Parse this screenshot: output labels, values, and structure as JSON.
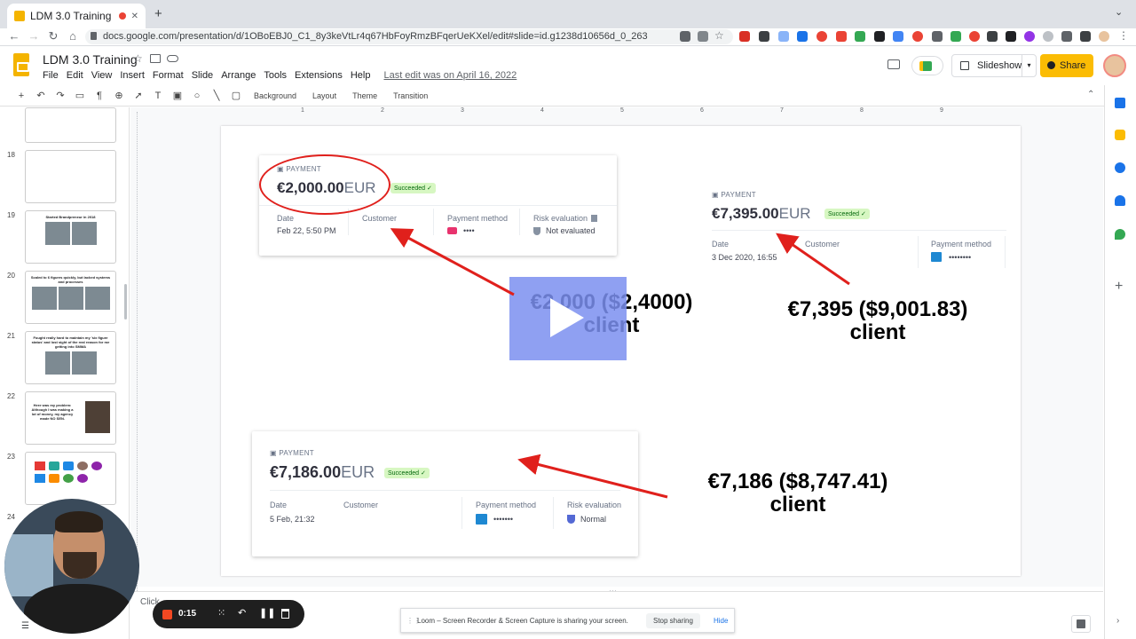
{
  "browser": {
    "tab_title": "LDM 3.0 Training - Google",
    "new_tab": "+",
    "close": "✕",
    "url": "docs.google.com/presentation/d/1OBoEBJ0_C1_8y3keVtLr4q67HbFoyRmzBFqerUeKXel/edit#slide=id.g1238d10656d_0_263"
  },
  "docs": {
    "title": "LDM 3.0 Training",
    "menu": [
      "File",
      "Edit",
      "View",
      "Insert",
      "Format",
      "Slide",
      "Arrange",
      "Tools",
      "Extensions",
      "Help"
    ],
    "last_edit": "Last edit was on April 16, 2022",
    "slideshow_label": "Slideshow",
    "share_label": "Share",
    "toolbar": {
      "background": "Background",
      "layout": "Layout",
      "theme": "Theme",
      "transition": "Transition"
    }
  },
  "filmstrip": {
    "slides": [
      {
        "num": "18",
        "text": ""
      },
      {
        "num": "19",
        "text": "Started Brandpreneur in 2018"
      },
      {
        "num": "20",
        "text": "Scaled to 6 figures quickly, but lacked systems and processes"
      },
      {
        "num": "21",
        "text": "Fought really hard to maintain my 'six figure status' and lost sight of the real reason for me getting into SMMA"
      },
      {
        "num": "22",
        "text": "Here was my problem: Although I was making a lot of money, my agency made NO SEN."
      },
      {
        "num": "23",
        "text": ""
      },
      {
        "num": "24",
        "text": ""
      }
    ]
  },
  "ruler": [
    "1",
    "2",
    "3",
    "4",
    "5",
    "6",
    "7",
    "8",
    "9"
  ],
  "slide": {
    "card1": {
      "label": "PAYMENT",
      "amount": "€2,000.00",
      "currency": "EUR",
      "badge": "Succeeded ✓",
      "cols": [
        "Date",
        "Customer",
        "Payment method",
        "Risk evaluation"
      ],
      "date": "Feb 22, 5:50 PM",
      "pm": "••••",
      "risk": "Not evaluated"
    },
    "card2": {
      "label": "PAYMENT",
      "amount": "€7,395.00",
      "currency": "EUR",
      "badge": "Succeeded ✓",
      "cols": [
        "Date",
        "Customer",
        "Payment method"
      ],
      "date": "3 Dec 2020, 16:55",
      "pm": "••••••••"
    },
    "card3": {
      "label": "PAYMENT",
      "amount": "€7,186.00",
      "currency": "EUR",
      "badge": "Succeeded ✓",
      "cols": [
        "Date",
        "Customer",
        "Payment method",
        "Risk evaluation"
      ],
      "date": "5 Feb, 21:32",
      "pm": "•••••••",
      "risk": "Normal"
    },
    "caption1": {
      "line1": "€2,000 ($2,4000)",
      "line2": "client"
    },
    "caption2": {
      "line1": "€7,395 ($9,001.83)",
      "line2": "client"
    },
    "caption3": {
      "line1": "€7,186 ($8,747.41)",
      "line2": "client"
    }
  },
  "speaker_notes_stub": "Click",
  "loom": {
    "time": "0:15",
    "notice": "Loom – Screen Recorder & Screen Capture is sharing your screen.",
    "stop": "Stop sharing",
    "hide": "Hide"
  },
  "colors": {
    "accent_red": "#e0201c",
    "share_yellow": "#fbbc04",
    "play_overlay": "#7b8ff0"
  }
}
